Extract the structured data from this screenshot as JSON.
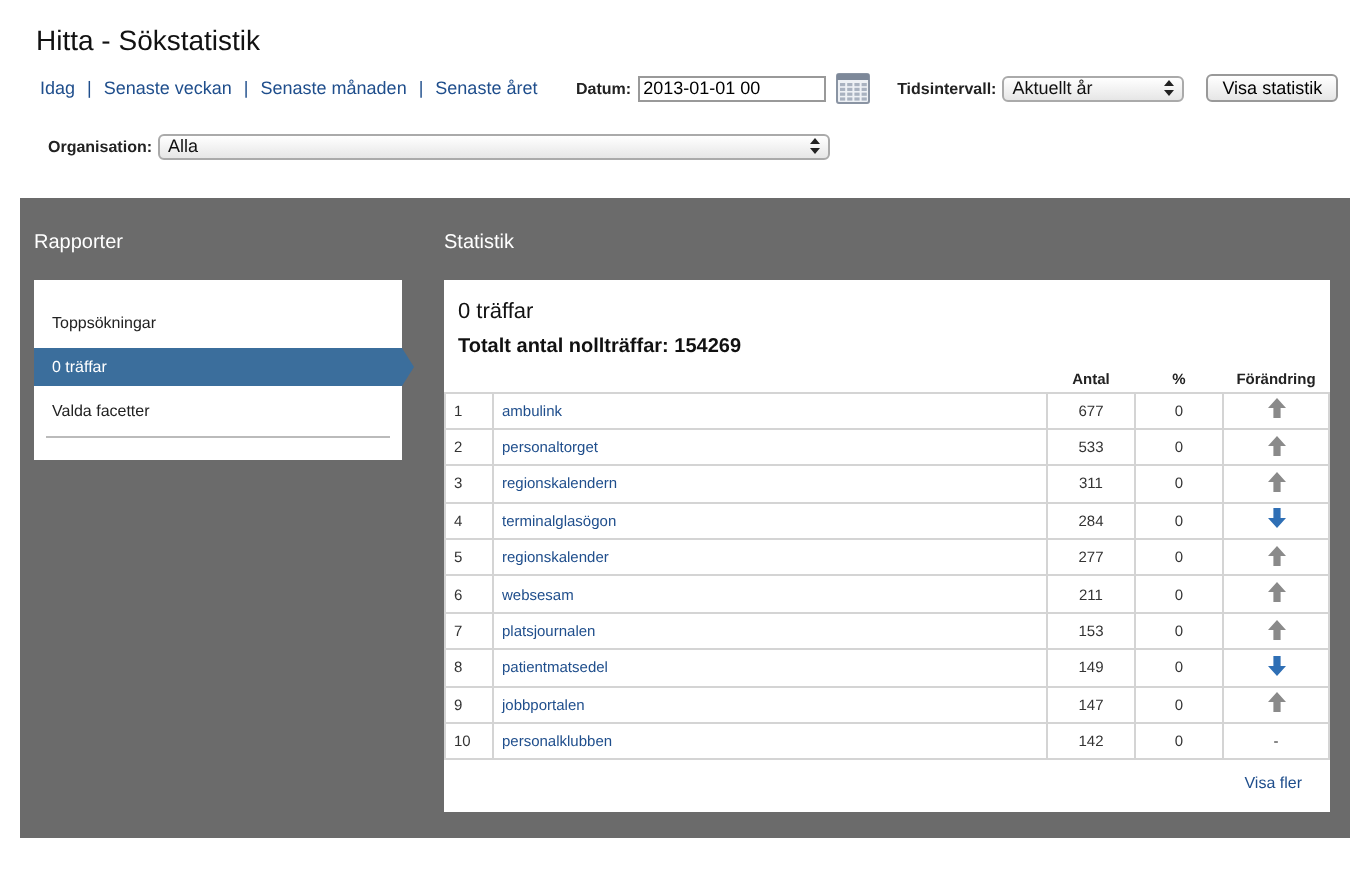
{
  "page_title": "Hitta - Sökstatistik",
  "quick_links": [
    "Idag",
    "Senaste veckan",
    "Senaste månaden",
    "Senaste året"
  ],
  "link_separator": "|",
  "date": {
    "label": "Datum:",
    "value": "2013-01-01 00"
  },
  "interval": {
    "label": "Tidsintervall:",
    "value": "Aktuellt år"
  },
  "show_button": "Visa statistik",
  "organisation": {
    "label": "Organisation:",
    "value": "Alla"
  },
  "sidebar": {
    "title": "Rapporter",
    "items": [
      {
        "label": "Toppsökningar",
        "selected": false
      },
      {
        "label": "0 träffar",
        "selected": true
      },
      {
        "label": "Valda facetter",
        "selected": false
      }
    ]
  },
  "stats": {
    "title": "Statistik",
    "heading": "0 träffar",
    "total": "Totalt antal nollträffar: 154269",
    "columns": [
      "Antal",
      "%",
      "Förändring"
    ],
    "rows": [
      {
        "rank": "1",
        "term": "ambulink",
        "count": "677",
        "percent": "0",
        "trend": {
          "kind": "up"
        }
      },
      {
        "rank": "2",
        "term": "personaltorget",
        "count": "533",
        "percent": "0",
        "trend": {
          "kind": "up"
        }
      },
      {
        "rank": "3",
        "term": "regionskalendern",
        "count": "311",
        "percent": "0",
        "trend": {
          "kind": "up"
        }
      },
      {
        "rank": "4",
        "term": "terminalglasögon",
        "count": "284",
        "percent": "0",
        "trend": {
          "kind": "down"
        }
      },
      {
        "rank": "5",
        "term": "regionskalender",
        "count": "277",
        "percent": "0",
        "trend": {
          "kind": "up"
        }
      },
      {
        "rank": "6",
        "term": "websesam",
        "count": "211",
        "percent": "0",
        "trend": {
          "kind": "up"
        }
      },
      {
        "rank": "7",
        "term": "platsjournalen",
        "count": "153",
        "percent": "0",
        "trend": {
          "kind": "up"
        }
      },
      {
        "rank": "8",
        "term": "patientmatsedel",
        "count": "149",
        "percent": "0",
        "trend": {
          "kind": "down"
        }
      },
      {
        "rank": "9",
        "term": "jobbportalen",
        "count": "147",
        "percent": "0",
        "trend": {
          "kind": "up"
        }
      },
      {
        "rank": "10",
        "term": "personalklubben",
        "count": "142",
        "percent": "0",
        "trend": {
          "kind": "none",
          "text": "-"
        }
      }
    ],
    "more_link": "Visa fler"
  }
}
